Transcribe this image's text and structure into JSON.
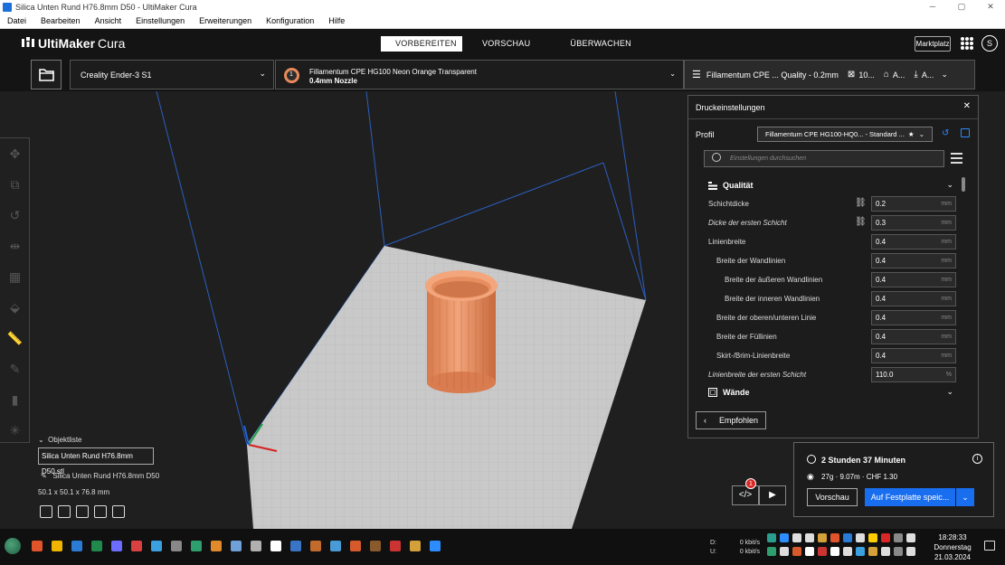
{
  "window": {
    "title": "Silica Unten Rund H76.8mm D50 - UltiMaker Cura",
    "controls": [
      "─",
      "▢",
      "✕"
    ]
  },
  "menu": {
    "items": [
      "Datei",
      "Bearbeiten",
      "Ansicht",
      "Einstellungen",
      "Erweiterungen",
      "Konfiguration",
      "Hilfe"
    ]
  },
  "header": {
    "logo_bold": "UltiMaker",
    "logo_light": "Cura",
    "stages": [
      "VORBEREITEN",
      "VORSCHAU",
      "ÜBERWACHEN"
    ],
    "active_stage": "VORBEREITEN",
    "marketplace": "Marktplatz",
    "avatar_initial": "S"
  },
  "toolbar": {
    "printer": "Creality Ender-3 S1",
    "extruder_number": "1",
    "material": "Fillamentum CPE HG100 Neon Orange Transparent",
    "nozzle": "0.4mm Nozzle",
    "print_setup": "Fillamentum CPE ... Quality - 0.2mm",
    "infill": "10...",
    "support": "A...",
    "adhesion": "A..."
  },
  "object_list": {
    "header": "Objektliste",
    "filename": "Silica Unten Rund H76.8mm D50.stl",
    "object_name": "Silica Unten Rund H76.8mm D50",
    "dimensions": "50.1 x 50.1 x 76.8 mm"
  },
  "settings_panel": {
    "title": "Druckeinstellungen",
    "profile_label": "Profil",
    "profile_value": "Fillamentum CPE HG100-HQ0... - Standard ...",
    "search_placeholder": "Einstellungen durchsuchen",
    "sections": [
      {
        "label": "Qualität"
      },
      {
        "label": "Wände"
      }
    ],
    "rows": [
      {
        "label": "Schichtdicke",
        "value": "0.2",
        "unit": "mm"
      },
      {
        "label": "Dicke der ersten Schicht",
        "value": "0.3",
        "unit": "mm"
      },
      {
        "label": "Linienbreite",
        "value": "0.4",
        "unit": "mm"
      },
      {
        "label": "Breite der Wandlinien",
        "value": "0.4",
        "unit": "mm"
      },
      {
        "label": "Breite der äußeren Wandlinien",
        "value": "0.4",
        "unit": "mm"
      },
      {
        "label": "Breite der inneren Wandlinien",
        "value": "0.4",
        "unit": "mm"
      },
      {
        "label": "Breite der oberen/unteren Linie",
        "value": "0.4",
        "unit": "mm"
      },
      {
        "label": "Breite der Füllinien",
        "value": "0.4",
        "unit": "mm"
      },
      {
        "label": "Skirt-/Brim-Linienbreite",
        "value": "0.4",
        "unit": "mm"
      },
      {
        "label": "Linienbreite der ersten Schicht",
        "value": "110.0",
        "unit": "%"
      }
    ],
    "recommended_button": "Empfohlen"
  },
  "output": {
    "print_time": "2 Stunden 37 Minuten",
    "material_estimate": "27g · 9.07m · CHF 1.30",
    "preview_button": "Vorschau",
    "save_button": "Auf Festplatte speic...",
    "plugin_badge": "1"
  },
  "taskbar": {
    "net_labels": [
      "D:",
      "U:"
    ],
    "net_values": [
      "0 kbit/s",
      "0 kbit/s"
    ],
    "time": "18:28:33",
    "day": "Donnerstag",
    "date": "21.03.2024",
    "app_colors": [
      "#e0542c",
      "#f0b400",
      "#2a7bd6",
      "#1f8a4c",
      "#6c6cff",
      "#d94040",
      "#3aa0e0",
      "#888888",
      "#2f9e6e",
      "#e08a2c",
      "#6fa0d8",
      "#b0b0b0",
      "#ffffff",
      "#3a74c4",
      "#c26b2c",
      "#4a9ad6",
      "#d65a2c",
      "#8a5a2c",
      "#cc3333",
      "#d4a03a",
      "#2d8cff"
    ]
  },
  "colors": {
    "accent": "#196ef0",
    "model": "#e98a5a",
    "build_plate": "#c9c9c9"
  }
}
